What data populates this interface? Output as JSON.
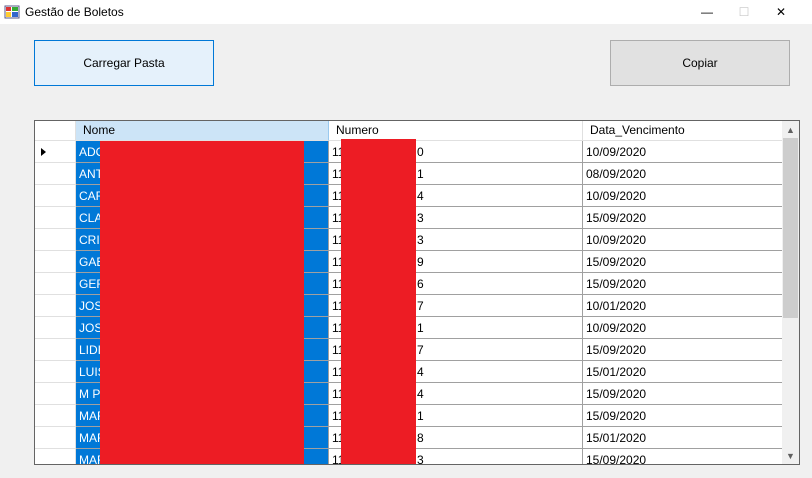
{
  "window": {
    "title": "Gestão de Boletos",
    "controls": {
      "minimize": "—",
      "maximize": "☐",
      "close": "✕"
    }
  },
  "toolbar": {
    "load_label": "Carregar Pasta",
    "copy_label": "Copiar"
  },
  "grid": {
    "columns": [
      "Nome",
      "Numero",
      "Data_Vencimento"
    ],
    "rows": [
      {
        "nome": "ADO",
        "numero_prefix": "11",
        "numero_suffix": "0",
        "data": "10/09/2020"
      },
      {
        "nome": "ANT",
        "numero_prefix": "11",
        "numero_suffix": "1",
        "data": "08/09/2020"
      },
      {
        "nome": "CAR",
        "numero_prefix": "11",
        "numero_suffix": "4",
        "data": "10/09/2020"
      },
      {
        "nome": "CLA",
        "numero_prefix": "11",
        "numero_suffix": "3",
        "data": "15/09/2020"
      },
      {
        "nome": "CRIS",
        "numero_prefix": "11",
        "numero_suffix": "3",
        "data": "10/09/2020"
      },
      {
        "nome": "GAB",
        "numero_prefix": "11",
        "numero_suffix": "9",
        "data": "15/09/2020"
      },
      {
        "nome": "GER",
        "numero_prefix": "11",
        "numero_suffix": "6",
        "data": "15/09/2020"
      },
      {
        "nome": "JOS",
        "numero_prefix": "11",
        "numero_suffix": "7",
        "data": "10/01/2020"
      },
      {
        "nome": "JOS",
        "numero_prefix": "11",
        "numero_suffix": "1",
        "data": "10/09/2020"
      },
      {
        "nome": "LIDI",
        "numero_prefix": "11",
        "numero_suffix": "7",
        "data": "15/09/2020"
      },
      {
        "nome": "LUIS",
        "numero_prefix": "11",
        "numero_suffix": "4",
        "data": "15/01/2020"
      },
      {
        "nome": "M PI",
        "numero_prefix": "11",
        "numero_suffix": "4",
        "data": "15/09/2020"
      },
      {
        "nome": "MAR",
        "numero_prefix": "11",
        "numero_suffix": "1",
        "data": "15/09/2020"
      },
      {
        "nome": "MAR",
        "numero_prefix": "11",
        "numero_suffix": "8",
        "data": "15/01/2020"
      },
      {
        "nome": "MAR",
        "numero_prefix": "11",
        "numero_suffix": "3",
        "data": "15/09/2020"
      }
    ]
  },
  "colors": {
    "selection": "#0078d7",
    "redaction": "#ed1c24",
    "header_selected": "#cce4f7"
  }
}
